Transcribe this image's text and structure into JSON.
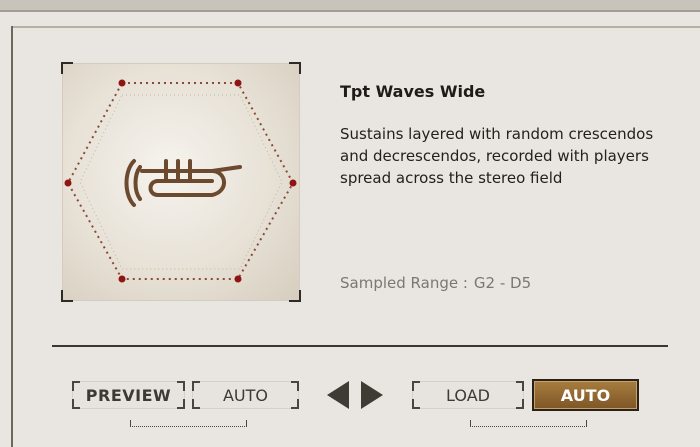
{
  "patch": {
    "title": "Tpt Waves Wide",
    "description": "Sustains layered with random crescendos and decrescendos, recorded with players spread across the stereo field",
    "range_label": "Sampled Range :",
    "range_value": "G2 - D5",
    "icon": "trumpet-icon"
  },
  "controls": {
    "preview_label": "PREVIEW",
    "auto_left_label": "AUTO",
    "load_label": "LOAD",
    "auto_right_label": "AUTO",
    "auto_right_active": true
  },
  "colors": {
    "accent_button": "#8a612e",
    "dot_marker": "#a01010"
  }
}
